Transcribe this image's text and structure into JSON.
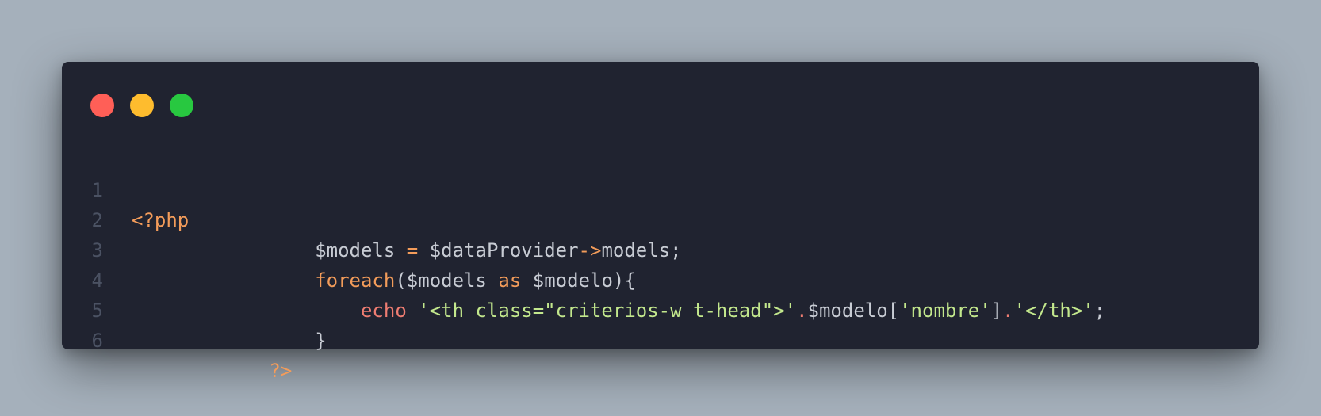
{
  "window": {
    "controls": [
      "close",
      "minimize",
      "maximize"
    ],
    "colors": {
      "close": "#ff5f57",
      "minimize": "#febc2e",
      "maximize": "#28c840",
      "background": "#202330"
    }
  },
  "code": {
    "language": "php",
    "line_numbers": [
      "1",
      "2",
      "3",
      "4",
      "5",
      "6"
    ],
    "lines": {
      "l1": {
        "open_tag": "<?php"
      },
      "l2": {
        "indent": "                ",
        "var_models": "$models",
        "assign": " = ",
        "var_provider": "$dataProvider",
        "arrow": "->",
        "rest": "models;"
      },
      "l3": {
        "indent": "                ",
        "kw_foreach": "foreach",
        "paren_open": "($models ",
        "kw_as": "as",
        "rest": " $modelo){"
      },
      "l4": {
        "indent": "                    ",
        "kw_echo": "echo",
        "space": " ",
        "str1": "'<th class=\"criterios-w t-head\">'",
        "dot1": ".",
        "var_modelo": "$modelo[",
        "str2": "'nombre'",
        "bracket_close": "]",
        "dot2": ".",
        "str3": "'</th>'",
        "semicolon": ";"
      },
      "l5": {
        "indent": "                ",
        "brace": "}"
      },
      "l6": {
        "indent": "            ",
        "close_tag": "?>"
      }
    }
  }
}
